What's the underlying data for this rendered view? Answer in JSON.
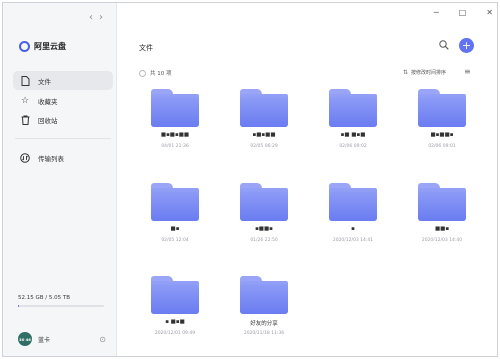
{
  "sidebar": {
    "nav_back": "‹",
    "nav_forward": "›",
    "brand": "阿里云盘",
    "items": [
      {
        "label": "文件",
        "icon": "file-icon"
      },
      {
        "label": "收藏夹",
        "icon": "star-icon"
      },
      {
        "label": "回收站",
        "icon": "trash-icon"
      },
      {
        "label": "传输列表",
        "icon": "transfer-icon"
      }
    ],
    "storage": {
      "text": "52.15 GB / 5.05 TB",
      "used_fraction": 0.01
    },
    "user": {
      "avatar_text": "30 46",
      "name": "蓝卡"
    }
  },
  "window_controls": [
    "─",
    "□",
    "✕"
  ],
  "main": {
    "title": "文件",
    "count": "共 10 项",
    "sort_label": "按修改时间排序"
  },
  "files": [
    {
      "name": "■▪■▪■■",
      "date": "04/01 21:36"
    },
    {
      "name": "▪■▪■■",
      "date": "02/05 06:29"
    },
    {
      "name": "▪■ ■▪■",
      "date": "02/06 09:02"
    },
    {
      "name": "■▪■■▪",
      "date": "02/06 09:01"
    },
    {
      "name": "■▪",
      "date": "02/05 12:04"
    },
    {
      "name": "▪■■▪",
      "date": "01/26 22:50"
    },
    {
      "name": "▪",
      "date": "2020/12/03 14:41"
    },
    {
      "name": "■■▪",
      "date": "2020/12/03 14:40"
    },
    {
      "name": "▪ ■▪■",
      "date": "2020/12/01 09:49"
    },
    {
      "name": "好友的分享",
      "date": "2020/11/18 11:36"
    }
  ]
}
